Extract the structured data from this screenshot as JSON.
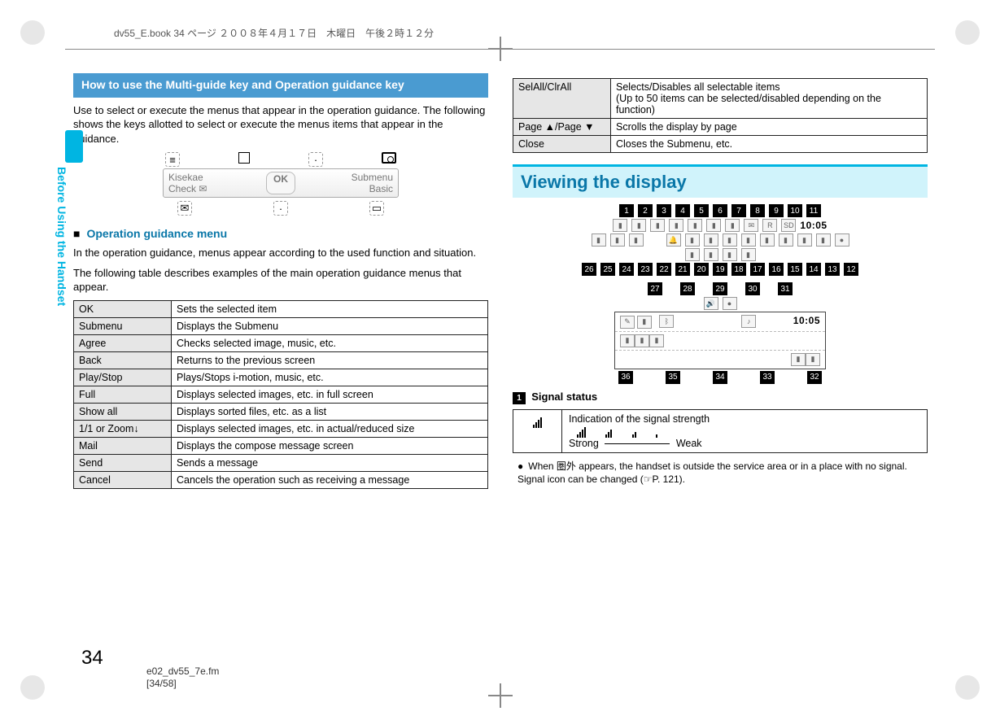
{
  "header_line": "dv55_E.book  34 ページ  ２００８年４月１７日　木曜日　午後２時１２分",
  "side_tab_label": "Before Using the Handset",
  "left": {
    "heading": "How to use the Multi-guide key and Operation guidance key",
    "intro": "Use to select or execute the menus that appear in the operation guidance. The following shows the keys allotted to select or execute the menus items that appear in the guidance.",
    "softkeys": {
      "line1_left": "Kisekae",
      "line1_right": "Submenu",
      "line2_left": "Check",
      "center": "OK",
      "line2_right": "Basic"
    },
    "sub_heading": "Operation guidance menu",
    "sub_para1": "In the operation guidance, menus appear according to the used function and situation.",
    "sub_para2": "The following table describes examples of the main operation guidance menus that appear.",
    "table": [
      [
        "OK",
        "Sets the selected item"
      ],
      [
        "Submenu",
        "Displays the Submenu"
      ],
      [
        "Agree",
        "Checks selected image, music, etc."
      ],
      [
        "Back",
        "Returns to the previous screen"
      ],
      [
        "Play/Stop",
        "Plays/Stops i-motion, music, etc."
      ],
      [
        "Full",
        "Displays selected images, etc. in full screen"
      ],
      [
        "Show all",
        "Displays sorted files, etc. as a list"
      ],
      [
        "1/1 or Zoom↓",
        "Displays selected images, etc. in actual/reduced size"
      ],
      [
        "Mail",
        "Displays the compose message screen"
      ],
      [
        "Send",
        "Sends a message"
      ],
      [
        "Cancel",
        "Cancels the operation such as receiving a message"
      ]
    ]
  },
  "right": {
    "table_cont": [
      [
        "SelAll/ClrAll",
        "Selects/Disables all selectable items\n(Up to 50 items can be selected/disabled depending on the function)"
      ],
      [
        "Page ▲/Page ▼",
        "Scrolls the display by page"
      ],
      [
        "Close",
        "Closes the Submenu, etc."
      ]
    ],
    "display_heading": "Viewing the display",
    "num_top": [
      "1",
      "2",
      "3",
      "4",
      "5",
      "6",
      "7",
      "8",
      "9",
      "10",
      "11"
    ],
    "time1": "10:05",
    "num_mid": [
      "26",
      "25",
      "24",
      "23",
      "22",
      "21",
      "20",
      "19",
      "18",
      "17",
      "16",
      "15",
      "14",
      "13",
      "12"
    ],
    "num_lower_top": [
      "27",
      "28",
      "29",
      "30",
      "31"
    ],
    "time2": "10:05",
    "num_bottom": [
      "36",
      "35",
      "34",
      "33",
      "32"
    ],
    "signal_heading": "1 Signal status",
    "signal_desc": "Indication of the signal strength",
    "signal_strong": "Strong",
    "signal_weak": "Weak",
    "bullet": "When 圏外 appears, the handset is outside the service area or in a place with no signal. Signal icon can be changed (☞P. 121)."
  },
  "page_number": "34",
  "footer_line1": "e02_dv55_7e.fm",
  "footer_line2": "[34/58]"
}
